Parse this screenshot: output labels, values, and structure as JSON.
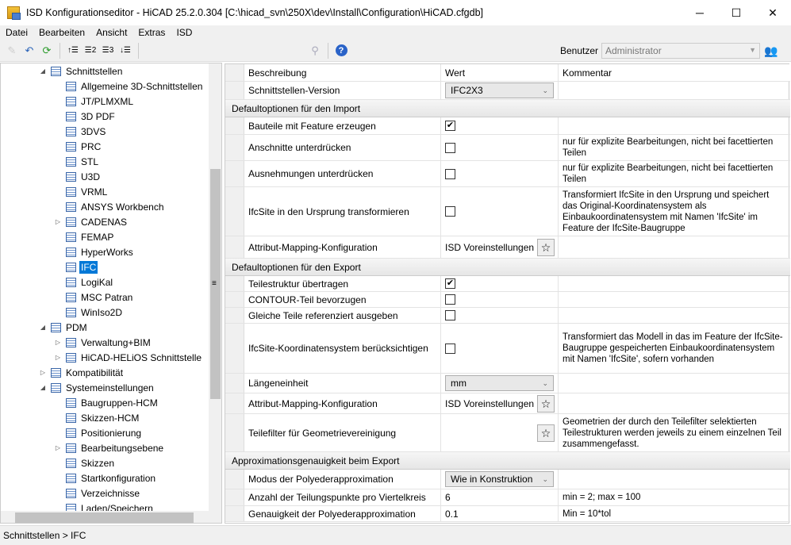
{
  "window": {
    "title": "ISD Konfigurationseditor  - HiCAD 25.2.0.304 [C:\\hicad_svn\\250X\\dev\\Install\\Configuration\\HiCAD.cfgdb]",
    "minimize": "─",
    "maximize": "☐",
    "close": "✕"
  },
  "menu": [
    "Datei",
    "Bearbeiten",
    "Ansicht",
    "Extras",
    "ISD"
  ],
  "toolbar": {
    "icons": [
      "pencil-icon",
      "undo-icon",
      "refresh-icon",
      "expand-level-1-icon",
      "level-2-icon",
      "level-3-icon",
      "collapse-all-icon",
      "binoculars-icon",
      "help-icon"
    ],
    "user_label": "Benutzer",
    "user_value": "Administrator"
  },
  "tree": [
    {
      "label": "Schnittstellen",
      "level": 0,
      "expander": "expanded"
    },
    {
      "label": "Allgemeine 3D-Schnittstellen",
      "level": 1
    },
    {
      "label": "JT/PLMXML",
      "level": 1
    },
    {
      "label": "3D PDF",
      "level": 1
    },
    {
      "label": "3DVS",
      "level": 1
    },
    {
      "label": "PRC",
      "level": 1
    },
    {
      "label": "STL",
      "level": 1
    },
    {
      "label": "U3D",
      "level": 1
    },
    {
      "label": "VRML",
      "level": 1
    },
    {
      "label": "ANSYS Workbench",
      "level": 1
    },
    {
      "label": "CADENAS",
      "level": 1,
      "expander": "collapsed"
    },
    {
      "label": "FEMAP",
      "level": 1
    },
    {
      "label": "HyperWorks",
      "level": 1
    },
    {
      "label": "IFC",
      "level": 1,
      "selected": true
    },
    {
      "label": "LogiKal",
      "level": 1
    },
    {
      "label": "MSC Patran",
      "level": 1
    },
    {
      "label": "WinIso2D",
      "level": 1
    },
    {
      "label": "PDM",
      "level": 0,
      "expander": "expanded"
    },
    {
      "label": "Verwaltung+BIM",
      "level": 1,
      "expander": "collapsed"
    },
    {
      "label": "HiCAD-HELiOS Schnittstelle",
      "level": 1,
      "expander": "collapsed"
    },
    {
      "label": "Kompatibilität",
      "level": 0,
      "expander": "collapsed"
    },
    {
      "label": "Systemeinstellungen",
      "level": 0,
      "expander": "expanded"
    },
    {
      "label": "Baugruppen-HCM",
      "level": 1
    },
    {
      "label": "Skizzen-HCM",
      "level": 1
    },
    {
      "label": "Positionierung",
      "level": 1
    },
    {
      "label": "Bearbeitungsebene",
      "level": 1,
      "expander": "collapsed"
    },
    {
      "label": "Skizzen",
      "level": 1
    },
    {
      "label": "Startkonfiguration",
      "level": 1
    },
    {
      "label": "Verzeichnisse",
      "level": 1
    },
    {
      "label": "Laden/Speichern",
      "level": 1
    }
  ],
  "grid": {
    "headers": [
      "Beschreibung",
      "Wert",
      "Kommentar"
    ],
    "rows": [
      {
        "type": "row",
        "desc": "Schnittstellen-Version",
        "kind": "combo",
        "value": "IFC2X3",
        "comment": ""
      },
      {
        "type": "group",
        "title": "Defaultoptionen für den Import"
      },
      {
        "type": "row",
        "desc": "Bauteile mit Feature erzeugen",
        "kind": "check",
        "checked": true,
        "comment": ""
      },
      {
        "type": "row",
        "desc": "Anschnitte unterdrücken",
        "kind": "check",
        "checked": false,
        "comment": "nur für explizite Bearbeitungen, nicht bei facettierten Teilen"
      },
      {
        "type": "row",
        "desc": "Ausnehmungen unterdrücken",
        "kind": "check",
        "checked": false,
        "comment": "nur für explizite Bearbeitungen, nicht bei facettierten Teilen"
      },
      {
        "type": "row",
        "desc": "IfcSite in den Ursprung transformieren",
        "kind": "check",
        "checked": false,
        "comment": "Transformiert IfcSite in den Ursprung und speichert das Original-Koordinatensystem als Einbaukoordinatensystem mit Namen 'IfcSite' im Feature der IfcSite-Baugruppe"
      },
      {
        "type": "row",
        "desc": "Attribut-Mapping-Konfiguration",
        "kind": "star",
        "value": "ISD Voreinstellungen",
        "comment": ""
      },
      {
        "type": "group",
        "title": "Defaultoptionen für den Export"
      },
      {
        "type": "row",
        "desc": "Teilestruktur übertragen",
        "kind": "check",
        "checked": true,
        "comment": ""
      },
      {
        "type": "row",
        "desc": "CONTOUR-Teil bevorzugen",
        "kind": "check",
        "checked": false,
        "comment": ""
      },
      {
        "type": "row",
        "desc": "Gleiche Teile referenziert ausgeben",
        "kind": "check",
        "checked": false,
        "comment": ""
      },
      {
        "type": "row",
        "desc": "IfcSite-Koordinatensystem berücksichtigen",
        "kind": "check",
        "checked": false,
        "comment": "Transformiert das Modell in das im Feature der IfcSite-Baugruppe gespeicherten Einbaukoordinatensystem mit Namen 'IfcSite', sofern vorhanden"
      },
      {
        "type": "row",
        "desc": "Längeneinheit",
        "kind": "combo",
        "value": "mm",
        "comment": ""
      },
      {
        "type": "row",
        "desc": "Attribut-Mapping-Konfiguration",
        "kind": "star",
        "value": "ISD Voreinstellungen",
        "comment": ""
      },
      {
        "type": "row",
        "desc": "Teilefilter für Geometrievereinigung",
        "kind": "star",
        "value": "",
        "comment": "Geometrien der durch den Teilefilter selektierten Teilestrukturen werden jeweils zu einem einzelnen Teil zusammengefasst."
      },
      {
        "type": "group",
        "title": "Approximationsgenauigkeit beim Export"
      },
      {
        "type": "row",
        "desc": "Modus der Polyederapproximation",
        "kind": "combo",
        "value": "Wie in Konstruktion",
        "comment": ""
      },
      {
        "type": "row",
        "desc": "Anzahl der Teilungspunkte pro Viertelkreis",
        "kind": "text",
        "value": "6",
        "comment": "min = 2; max = 100"
      },
      {
        "type": "row",
        "desc": "Genauigkeit der Polyederapproximation",
        "kind": "text",
        "value": "0.1",
        "comment": "Min = 10*tol"
      }
    ]
  },
  "status": "Schnittstellen > IFC"
}
